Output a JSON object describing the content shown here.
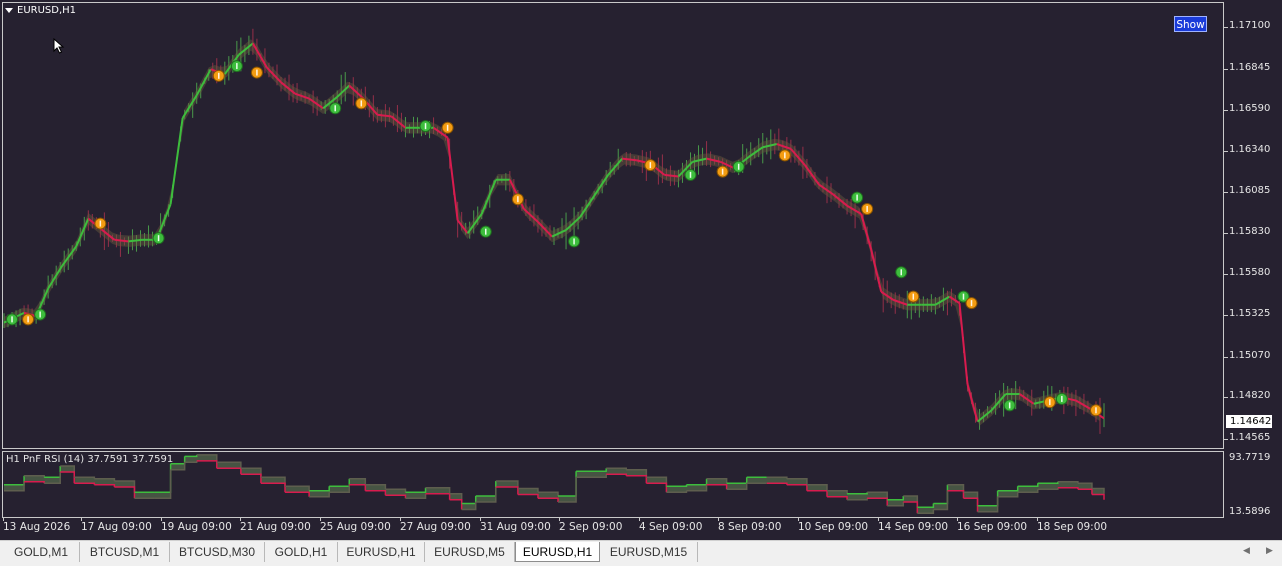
{
  "chart": {
    "symbol_title": "EURUSD,H1",
    "show_button": "Show",
    "current_price": "1.14642",
    "price_axis": [
      "1.17100",
      "1.16845",
      "1.16590",
      "1.16340",
      "1.16085",
      "1.15830",
      "1.15580",
      "1.15325",
      "1.15070",
      "1.14820",
      "1.14565"
    ],
    "time_axis": [
      "13 Aug 2026",
      "17 Aug 09:00",
      "19 Aug 09:00",
      "21 Aug 09:00",
      "25 Aug 09:00",
      "27 Aug 09:00",
      "31 Aug 09:00",
      "2 Sep 09:00",
      "4 Sep 09:00",
      "8 Sep 09:00",
      "10 Sep 09:00",
      "14 Sep 09:00",
      "16 Sep 09:00",
      "18 Sep 09:00"
    ],
    "indicator": {
      "title": "H1 PnF RSI (14) 37.7591 37.7591",
      "axis_max": "93.7719",
      "axis_min": "13.5896"
    },
    "colors": {
      "background": "#262130",
      "bull": "#3dbd3d",
      "bear": "#d81b4e",
      "bull_marker": "#3dbd3d",
      "bear_marker": "#f39c12",
      "show_button": "#1a3bd9"
    }
  },
  "tabs": [
    {
      "label": "GOLD,M1",
      "active": false
    },
    {
      "label": "BTCUSD,M1",
      "active": false
    },
    {
      "label": "BTCUSD,M30",
      "active": false
    },
    {
      "label": "GOLD,H1",
      "active": false
    },
    {
      "label": "EURUSD,H1",
      "active": false
    },
    {
      "label": "EURUSD,M5",
      "active": false
    },
    {
      "label": "EURUSD,H1",
      "active": true
    },
    {
      "label": "EURUSD,M15",
      "active": false
    }
  ],
  "chart_data": {
    "type": "line",
    "symbol": "EURUSD",
    "timeframe": "H1",
    "title": "EURUSD,H1",
    "ylim": [
      1.1452,
      1.1723
    ],
    "x_ticks": [
      "13 Aug 2026",
      "17 Aug 09:00",
      "19 Aug 09:00",
      "21 Aug 09:00",
      "25 Aug 09:00",
      "27 Aug 09:00",
      "31 Aug 09:00",
      "2 Sep 09:00",
      "4 Sep 09:00",
      "8 Sep 09:00",
      "10 Sep 09:00",
      "14 Sep 09:00",
      "16 Sep 09:00",
      "18 Sep 09:00"
    ],
    "y_ticks": [
      1.171,
      1.16845,
      1.1659,
      1.1634,
      1.16085,
      1.1583,
      1.1558,
      1.15325,
      1.1507,
      1.1482,
      1.14565
    ],
    "price_series": [
      {
        "bar": 0,
        "price": 1.1528
      },
      {
        "bar": 5,
        "price": 1.1531
      },
      {
        "bar": 10,
        "price": 1.1534
      },
      {
        "bar": 16,
        "price": 1.1532
      },
      {
        "bar": 22,
        "price": 1.1549
      },
      {
        "bar": 29,
        "price": 1.1563
      },
      {
        "bar": 36,
        "price": 1.1575
      },
      {
        "bar": 42,
        "price": 1.1592
      },
      {
        "bar": 48,
        "price": 1.1586
      },
      {
        "bar": 55,
        "price": 1.1579
      },
      {
        "bar": 62,
        "price": 1.1578
      },
      {
        "bar": 69,
        "price": 1.1579
      },
      {
        "bar": 76,
        "price": 1.1579
      },
      {
        "bar": 83,
        "price": 1.1601
      },
      {
        "bar": 89,
        "price": 1.1654
      },
      {
        "bar": 96,
        "price": 1.1668
      },
      {
        "bar": 103,
        "price": 1.1684
      },
      {
        "bar": 110,
        "price": 1.1681
      },
      {
        "bar": 117,
        "price": 1.1693
      },
      {
        "bar": 124,
        "price": 1.17
      },
      {
        "bar": 131,
        "price": 1.1685
      },
      {
        "bar": 138,
        "price": 1.1676
      },
      {
        "bar": 145,
        "price": 1.1669
      },
      {
        "bar": 152,
        "price": 1.1666
      },
      {
        "bar": 159,
        "price": 1.166
      },
      {
        "bar": 166,
        "price": 1.1667
      },
      {
        "bar": 172,
        "price": 1.1674
      },
      {
        "bar": 179,
        "price": 1.1666
      },
      {
        "bar": 186,
        "price": 1.1656
      },
      {
        "bar": 193,
        "price": 1.1655
      },
      {
        "bar": 200,
        "price": 1.1648
      },
      {
        "bar": 207,
        "price": 1.1648
      },
      {
        "bar": 214,
        "price": 1.1648
      },
      {
        "bar": 221,
        "price": 1.1642
      },
      {
        "bar": 226,
        "price": 1.1591
      },
      {
        "bar": 231,
        "price": 1.1583
      },
      {
        "bar": 238,
        "price": 1.1595
      },
      {
        "bar": 245,
        "price": 1.1616
      },
      {
        "bar": 252,
        "price": 1.1616
      },
      {
        "bar": 259,
        "price": 1.1598
      },
      {
        "bar": 266,
        "price": 1.159
      },
      {
        "bar": 273,
        "price": 1.1581
      },
      {
        "bar": 280,
        "price": 1.1585
      },
      {
        "bar": 287,
        "price": 1.1593
      },
      {
        "bar": 294,
        "price": 1.1606
      },
      {
        "bar": 301,
        "price": 1.1619
      },
      {
        "bar": 308,
        "price": 1.1629
      },
      {
        "bar": 315,
        "price": 1.1628
      },
      {
        "bar": 322,
        "price": 1.1626
      },
      {
        "bar": 329,
        "price": 1.1619
      },
      {
        "bar": 336,
        "price": 1.1618
      },
      {
        "bar": 343,
        "price": 1.1627
      },
      {
        "bar": 350,
        "price": 1.1629
      },
      {
        "bar": 357,
        "price": 1.1627
      },
      {
        "bar": 364,
        "price": 1.1623
      },
      {
        "bar": 371,
        "price": 1.163
      },
      {
        "bar": 378,
        "price": 1.1636
      },
      {
        "bar": 385,
        "price": 1.1638
      },
      {
        "bar": 392,
        "price": 1.1635
      },
      {
        "bar": 399,
        "price": 1.1625
      },
      {
        "bar": 406,
        "price": 1.1613
      },
      {
        "bar": 413,
        "price": 1.1607
      },
      {
        "bar": 420,
        "price": 1.16
      },
      {
        "bar": 427,
        "price": 1.1595
      },
      {
        "bar": 432,
        "price": 1.1573
      },
      {
        "bar": 437,
        "price": 1.1547
      },
      {
        "bar": 443,
        "price": 1.1542
      },
      {
        "bar": 450,
        "price": 1.1539
      },
      {
        "bar": 457,
        "price": 1.1539
      },
      {
        "bar": 464,
        "price": 1.1539
      },
      {
        "bar": 471,
        "price": 1.1544
      },
      {
        "bar": 476,
        "price": 1.154
      },
      {
        "bar": 480,
        "price": 1.149
      },
      {
        "bar": 485,
        "price": 1.1467
      },
      {
        "bar": 492,
        "price": 1.1474
      },
      {
        "bar": 499,
        "price": 1.1484
      },
      {
        "bar": 506,
        "price": 1.1484
      },
      {
        "bar": 513,
        "price": 1.1478
      },
      {
        "bar": 520,
        "price": 1.148
      },
      {
        "bar": 527,
        "price": 1.1482
      },
      {
        "bar": 534,
        "price": 1.148
      },
      {
        "bar": 541,
        "price": 1.1475
      },
      {
        "bar": 548,
        "price": 1.1469
      }
    ],
    "bull_markers": [
      {
        "bar": 4,
        "price": 1.153
      },
      {
        "bar": 18,
        "price": 1.1533
      },
      {
        "bar": 77,
        "price": 1.158
      },
      {
        "bar": 116,
        "price": 1.1686
      },
      {
        "bar": 165,
        "price": 1.166
      },
      {
        "bar": 210,
        "price": 1.1649
      },
      {
        "bar": 240,
        "price": 1.1584
      },
      {
        "bar": 284,
        "price": 1.1578
      },
      {
        "bar": 342,
        "price": 1.1619
      },
      {
        "bar": 366,
        "price": 1.1624
      },
      {
        "bar": 425,
        "price": 1.1605
      },
      {
        "bar": 447,
        "price": 1.1559
      },
      {
        "bar": 478,
        "price": 1.1544
      },
      {
        "bar": 501,
        "price": 1.1477
      },
      {
        "bar": 527,
        "price": 1.1481
      }
    ],
    "bear_markers": [
      {
        "bar": 12,
        "price": 1.153
      },
      {
        "bar": 48,
        "price": 1.1589
      },
      {
        "bar": 107,
        "price": 1.168
      },
      {
        "bar": 126,
        "price": 1.1682
      },
      {
        "bar": 178,
        "price": 1.1663
      },
      {
        "bar": 221,
        "price": 1.1648
      },
      {
        "bar": 256,
        "price": 1.1604
      },
      {
        "bar": 322,
        "price": 1.1625
      },
      {
        "bar": 358,
        "price": 1.1621
      },
      {
        "bar": 389,
        "price": 1.1631
      },
      {
        "bar": 430,
        "price": 1.1598
      },
      {
        "bar": 453,
        "price": 1.1544
      },
      {
        "bar": 482,
        "price": 1.154
      },
      {
        "bar": 521,
        "price": 1.1479
      },
      {
        "bar": 544,
        "price": 1.1474
      }
    ],
    "indicator": {
      "name": "H1 PnF RSI (14)",
      "ylim": [
        13.5896,
        93.7719
      ],
      "series": [
        {
          "bar": 0,
          "value": 50
        },
        {
          "bar": 10,
          "value": 62
        },
        {
          "bar": 20,
          "value": 60
        },
        {
          "bar": 28,
          "value": 75
        },
        {
          "bar": 35,
          "value": 60
        },
        {
          "bar": 45,
          "value": 58
        },
        {
          "bar": 55,
          "value": 55
        },
        {
          "bar": 65,
          "value": 40
        },
        {
          "bar": 75,
          "value": 40
        },
        {
          "bar": 83,
          "value": 78
        },
        {
          "bar": 90,
          "value": 88
        },
        {
          "bar": 96,
          "value": 90
        },
        {
          "bar": 106,
          "value": 80
        },
        {
          "bar": 118,
          "value": 72
        },
        {
          "bar": 128,
          "value": 60
        },
        {
          "bar": 140,
          "value": 48
        },
        {
          "bar": 152,
          "value": 42
        },
        {
          "bar": 162,
          "value": 48
        },
        {
          "bar": 172,
          "value": 58
        },
        {
          "bar": 180,
          "value": 50
        },
        {
          "bar": 190,
          "value": 44
        },
        {
          "bar": 200,
          "value": 40
        },
        {
          "bar": 210,
          "value": 46
        },
        {
          "bar": 222,
          "value": 38
        },
        {
          "bar": 228,
          "value": 25
        },
        {
          "bar": 235,
          "value": 35
        },
        {
          "bar": 245,
          "value": 55
        },
        {
          "bar": 256,
          "value": 45
        },
        {
          "bar": 266,
          "value": 40
        },
        {
          "bar": 276,
          "value": 35
        },
        {
          "bar": 285,
          "value": 68
        },
        {
          "bar": 300,
          "value": 72
        },
        {
          "bar": 310,
          "value": 70
        },
        {
          "bar": 320,
          "value": 60
        },
        {
          "bar": 330,
          "value": 48
        },
        {
          "bar": 340,
          "value": 50
        },
        {
          "bar": 350,
          "value": 58
        },
        {
          "bar": 360,
          "value": 52
        },
        {
          "bar": 370,
          "value": 60
        },
        {
          "bar": 380,
          "value": 60
        },
        {
          "bar": 390,
          "value": 58
        },
        {
          "bar": 400,
          "value": 50
        },
        {
          "bar": 410,
          "value": 42
        },
        {
          "bar": 420,
          "value": 38
        },
        {
          "bar": 430,
          "value": 40
        },
        {
          "bar": 440,
          "value": 30
        },
        {
          "bar": 448,
          "value": 35
        },
        {
          "bar": 455,
          "value": 20
        },
        {
          "bar": 463,
          "value": 25
        },
        {
          "bar": 470,
          "value": 50
        },
        {
          "bar": 478,
          "value": 40
        },
        {
          "bar": 485,
          "value": 22
        },
        {
          "bar": 495,
          "value": 42
        },
        {
          "bar": 505,
          "value": 48
        },
        {
          "bar": 515,
          "value": 52
        },
        {
          "bar": 525,
          "value": 54
        },
        {
          "bar": 535,
          "value": 52
        },
        {
          "bar": 542,
          "value": 45
        },
        {
          "bar": 548,
          "value": 38
        }
      ]
    },
    "grid": false
  }
}
